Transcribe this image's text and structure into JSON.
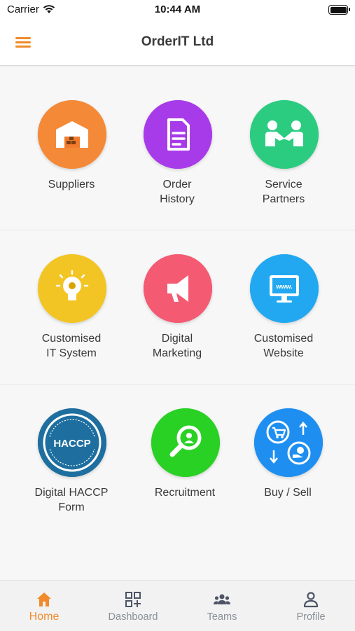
{
  "status_bar": {
    "carrier": "Carrier",
    "time": "10:44 AM"
  },
  "header": {
    "title": "OrderIT Ltd",
    "menu_icon": "hamburger-icon",
    "accent": "#f08a2a"
  },
  "grid": [
    {
      "label": "Suppliers",
      "icon": "warehouse-icon",
      "color": "#f27c2b"
    },
    {
      "label": "Order\nHistory",
      "icon": "document-icon",
      "color": "#a434e8"
    },
    {
      "label": "Service\nPartners",
      "icon": "handshake-icon",
      "color": "#29c97b"
    },
    {
      "label": "Customised\nIT System",
      "icon": "lightbulb-icon",
      "color": "#f0c21a"
    },
    {
      "label": "Digital\nMarketing",
      "icon": "megaphone-icon",
      "color": "#f2516b"
    },
    {
      "label": "Customised\nWebsite",
      "icon": "monitor-icon",
      "color": "#1aa3f0"
    },
    {
      "label": "Digital HACCP\nForm",
      "icon": "haccp-badge-icon",
      "badge_text": "HACCP",
      "color": "#1d6b9a"
    },
    {
      "label": "Recruitment",
      "icon": "search-person-icon",
      "color": "#23cc1f"
    },
    {
      "label": "Buy / Sell",
      "icon": "exchange-icon",
      "color": "#1a8cf0"
    }
  ],
  "tabs": [
    {
      "label": "Home",
      "icon": "home-icon",
      "active": true
    },
    {
      "label": "Dashboard",
      "icon": "dashboard-icon",
      "active": false
    },
    {
      "label": "Teams",
      "icon": "teams-icon",
      "active": false
    },
    {
      "label": "Profile",
      "icon": "profile-icon",
      "active": false
    }
  ]
}
